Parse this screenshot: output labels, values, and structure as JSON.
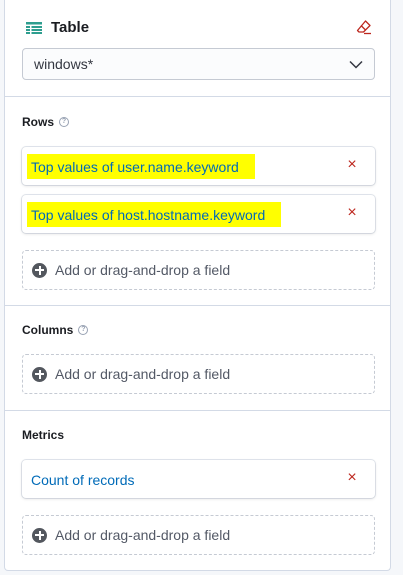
{
  "header": {
    "chart_type_label": "Table",
    "chart_type_icon": "table-icon",
    "clear_icon": "eraser-icon",
    "index_pattern": "windows*"
  },
  "sections": {
    "rows": {
      "title": "Rows",
      "fields": [
        {
          "label": "Top values of user.name.keyword",
          "highlighted": true
        },
        {
          "label": "Top values of host.hostname.keyword",
          "highlighted": true
        }
      ],
      "add_label": "Add or drag-and-drop a field"
    },
    "columns": {
      "title": "Columns",
      "add_label": "Add or drag-and-drop a field"
    },
    "metrics": {
      "title": "Metrics",
      "fields": [
        {
          "label": "Count of records",
          "highlighted": false
        }
      ],
      "add_label": "Add or drag-and-drop a field"
    }
  },
  "colors": {
    "accent": "#006bb8",
    "remove": "#bd271e",
    "highlight": "#ffff00",
    "brand_icon": "#2e9e8f"
  }
}
